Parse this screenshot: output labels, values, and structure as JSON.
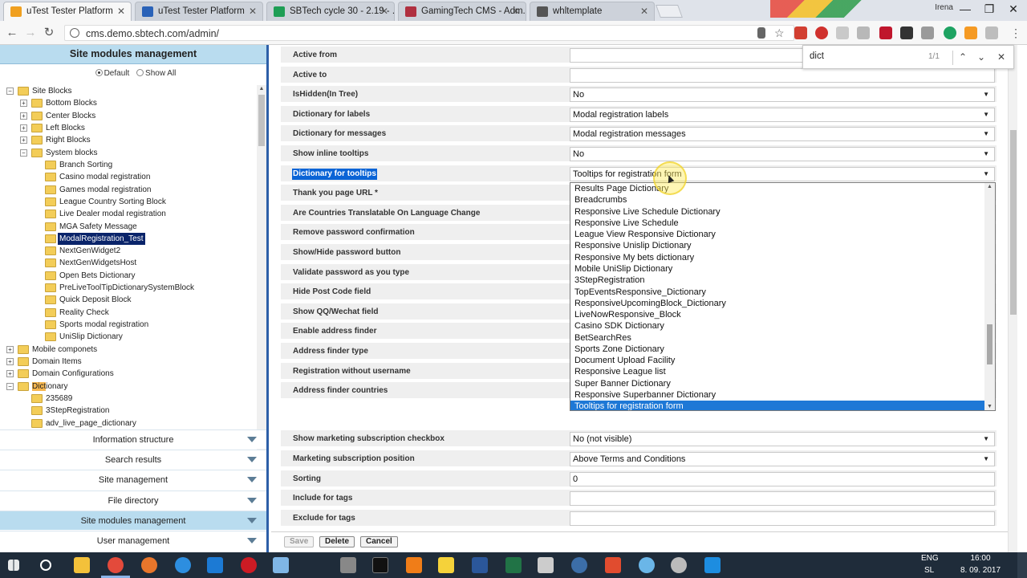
{
  "browser": {
    "tabs": [
      {
        "label": "uTest Tester Platform",
        "color": "#f0a020"
      },
      {
        "label": "uTest Tester Platform",
        "color": "#2a62b8"
      },
      {
        "label": "SBTech cycle 30 - 2.19 - ...",
        "color": "#1e9e55"
      },
      {
        "label": "GamingTech CMS - Adm...",
        "color": "#b03040"
      },
      {
        "label": "whltemplate",
        "color": "#555555"
      }
    ],
    "user": "Irena",
    "url": "cms.demo.sbtech.com/admin/",
    "window_minimize": "—",
    "window_restore": "❐",
    "window_close": "✕",
    "back": "←",
    "forward": "→",
    "reload": "↻",
    "tab_close": "✕"
  },
  "findbar": {
    "query": "dict",
    "count": "1/1",
    "prev": "⌃",
    "next": "⌄",
    "close": "✕"
  },
  "left": {
    "title": "Site modules management",
    "radio_default": "Default",
    "radio_all": "Show All",
    "tree": [
      {
        "label": "Site Blocks",
        "level": 0,
        "exp": "−"
      },
      {
        "label": "Bottom Blocks",
        "level": 1,
        "exp": "+"
      },
      {
        "label": "Center Blocks",
        "level": 1,
        "exp": "+"
      },
      {
        "label": "Left Blocks",
        "level": 1,
        "exp": "+"
      },
      {
        "label": "Right Blocks",
        "level": 1,
        "exp": "+"
      },
      {
        "label": "System blocks",
        "level": 1,
        "exp": "−"
      },
      {
        "label": "Branch Sorting",
        "level": 2,
        "exp": ""
      },
      {
        "label": "Casino modal registration",
        "level": 2,
        "exp": ""
      },
      {
        "label": "Games modal registration",
        "level": 2,
        "exp": ""
      },
      {
        "label": "League Country Sorting Block",
        "level": 2,
        "exp": ""
      },
      {
        "label": "Live Dealer modal registration",
        "level": 2,
        "exp": ""
      },
      {
        "label": "MGA Safety Message",
        "level": 2,
        "exp": ""
      },
      {
        "label": "ModalRegistration_Test",
        "level": 2,
        "exp": "",
        "selected": true
      },
      {
        "label": "NextGenWidget2",
        "level": 2,
        "exp": ""
      },
      {
        "label": "NextGenWidgetsHost",
        "level": 2,
        "exp": ""
      },
      {
        "label": "Open Bets Dictionary",
        "level": 2,
        "exp": ""
      },
      {
        "label": "PreLiveToolTipDictionarySystemBlock",
        "level": 2,
        "exp": ""
      },
      {
        "label": "Quick Deposit Block",
        "level": 2,
        "exp": ""
      },
      {
        "label": "Reality Check",
        "level": 2,
        "exp": ""
      },
      {
        "label": "Sports modal registration",
        "level": 2,
        "exp": ""
      },
      {
        "label": "UniSlip Dictionary",
        "level": 2,
        "exp": ""
      },
      {
        "label": "Mobile componets",
        "level": 0,
        "exp": "+"
      },
      {
        "label": "Domain Items",
        "level": 0,
        "exp": "+"
      },
      {
        "label": "Domain Configurations",
        "level": 0,
        "exp": "+"
      },
      {
        "label": "Dictionary",
        "level": 0,
        "exp": "−",
        "highlight": "Dict",
        "rest": "ionary"
      },
      {
        "label": "235689",
        "level": 1,
        "exp": ""
      },
      {
        "label": "3StepRegistration",
        "level": 1,
        "exp": ""
      },
      {
        "label": "adv_live_page_dictionary",
        "level": 1,
        "exp": ""
      }
    ],
    "accordion": [
      {
        "label": "Information structure",
        "blue": false
      },
      {
        "label": "Search results",
        "blue": false
      },
      {
        "label": "Site management",
        "blue": false
      },
      {
        "label": "File directory",
        "blue": false
      },
      {
        "label": "Site modules management",
        "blue": true
      },
      {
        "label": "User management",
        "blue": false
      }
    ]
  },
  "form": {
    "rows_top": [
      {
        "label": "Active from",
        "value": "",
        "select": false
      },
      {
        "label": "Active to",
        "value": "",
        "select": false
      },
      {
        "label": "IsHidden(In Tree)",
        "value": "No",
        "select": true
      },
      {
        "label": "Dictionary for labels",
        "value": "Modal registration labels",
        "select": true
      },
      {
        "label": "Dictionary for messages",
        "value": "Modal registration messages",
        "select": true
      },
      {
        "label": "Show inline tooltips",
        "value": "No",
        "select": true
      },
      {
        "label": "Dictionary for tooltips",
        "value": "Tooltips for registration form",
        "select": true,
        "selected_label": true
      },
      {
        "label": "Thank you page URL *",
        "value": "",
        "select": false
      },
      {
        "label": "Are Countries Translatable On Language Change",
        "value": "",
        "select": false
      },
      {
        "label": "Remove password confirmation",
        "value": "",
        "select": false
      },
      {
        "label": "Show/Hide password button",
        "value": "",
        "select": false
      },
      {
        "label": "Validate password as you type",
        "value": "",
        "select": false
      },
      {
        "label": "Hide Post Code field",
        "value": "",
        "select": false
      },
      {
        "label": "Show QQ/Wechat field",
        "value": "",
        "select": false
      },
      {
        "label": "Enable address finder",
        "value": "",
        "select": false
      },
      {
        "label": "Address finder type",
        "value": "",
        "select": false
      },
      {
        "label": "Registration without username",
        "value": "",
        "select": false
      },
      {
        "label": "Address finder countries",
        "value": "",
        "select": false
      }
    ],
    "rows_bottom": [
      {
        "label": "Show marketing subscription checkbox",
        "value": "No (not visible)",
        "select": true
      },
      {
        "label": "Marketing subscription position",
        "value": "Above Terms and Conditions",
        "select": true
      },
      {
        "label": "Sorting",
        "value": "0",
        "select": false
      },
      {
        "label": "Include for tags",
        "value": "",
        "select": false
      },
      {
        "label": "Exclude for tags",
        "value": "",
        "select": false
      }
    ],
    "dropdown": [
      "Results Page Dictionary",
      "Breadcrumbs",
      "Responsive Live Schedule Dictionary",
      "Responsive Live Schedule",
      "League View Responsive Dictionary",
      "Responsive Unislip Dictionary",
      "Responsive My bets dictionary",
      "Mobile UniSlip Dictionary",
      "3StepRegistration",
      "TopEventsResponsive_Dictionary",
      "ResponsiveUpcomingBlock_Dictionary",
      "LiveNowResponsive_Block",
      "Casino SDK Dictionary",
      "BetSearchRes",
      "Sports Zone Dictionary",
      "Document Upload Facility",
      "Responsive League list",
      "Super Banner Dictionary",
      "Responsive Superbanner Dictionary",
      "Tooltips for registration form"
    ],
    "dropdown_selected": 19,
    "save_label": "Save",
    "delete_label": "Delete",
    "cancel_label": "Cancel"
  },
  "taskbar": {
    "lang_top": "ENG",
    "lang_bottom": "SL",
    "time": "16:00",
    "date": "8. 09. 2017"
  }
}
